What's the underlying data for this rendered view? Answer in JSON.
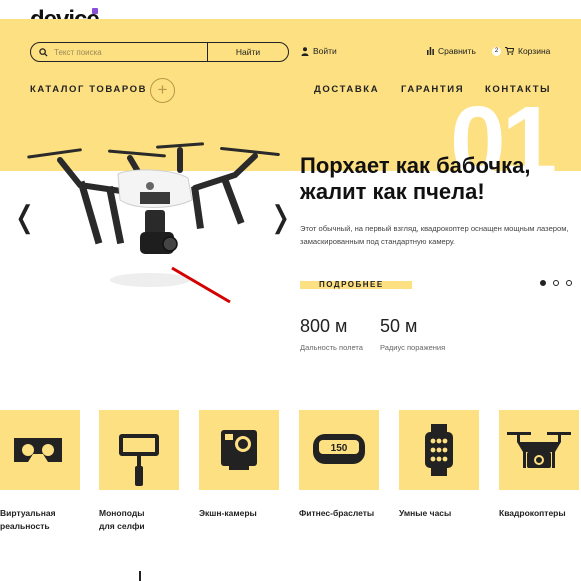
{
  "header": {
    "logo": "device",
    "search": {
      "placeholder": "Текст поиска",
      "button_label": "Найти"
    },
    "login_label": "Войти",
    "compare_label": "Сравнить",
    "cart_count": "2",
    "cart_label": "Корзина"
  },
  "nav": {
    "catalog": "КАТАЛОГ ТОВАРОВ",
    "delivery": "ДОСТАВКА",
    "warranty": "ГАРАНТИЯ",
    "contacts": "КОНТАКТЫ"
  },
  "hero": {
    "number": "01",
    "title_line1": "Порхает как бабочка,",
    "title_line2": "жалит как пчела!",
    "description": "Этот обычный, на первый взгляд, квадрокоптер оснащен мощным лазером, замаскированным под стандартную камеру.",
    "more_label": "ПОДРОБНЕЕ",
    "prev_arrow": "❬",
    "next_arrow": "❭",
    "stats": [
      {
        "value": "800 м",
        "label": "Дальность полета"
      },
      {
        "value": "50 м",
        "label": "Радиус поражения"
      }
    ]
  },
  "categories": [
    {
      "line1": "Виртуальная",
      "line2": "реальность",
      "icon": "vr-headset-icon"
    },
    {
      "line1": "Моноподы",
      "line2": "для селфи",
      "icon": "selfie-stick-icon"
    },
    {
      "line1": "Экшн-камеры",
      "line2": "",
      "icon": "action-camera-icon"
    },
    {
      "line1": "Фитнес-браслеты",
      "line2": "",
      "icon": "fitness-band-icon",
      "band_text": "150"
    },
    {
      "line1": "Умные часы",
      "line2": "",
      "icon": "smartwatch-icon"
    },
    {
      "line1": "Квадрокоптеры",
      "line2": "",
      "icon": "quadcopter-icon"
    }
  ],
  "colors": {
    "accent": "#fde081",
    "text": "#222222",
    "plus_border": "#b59a47",
    "laser": "#d40000"
  }
}
